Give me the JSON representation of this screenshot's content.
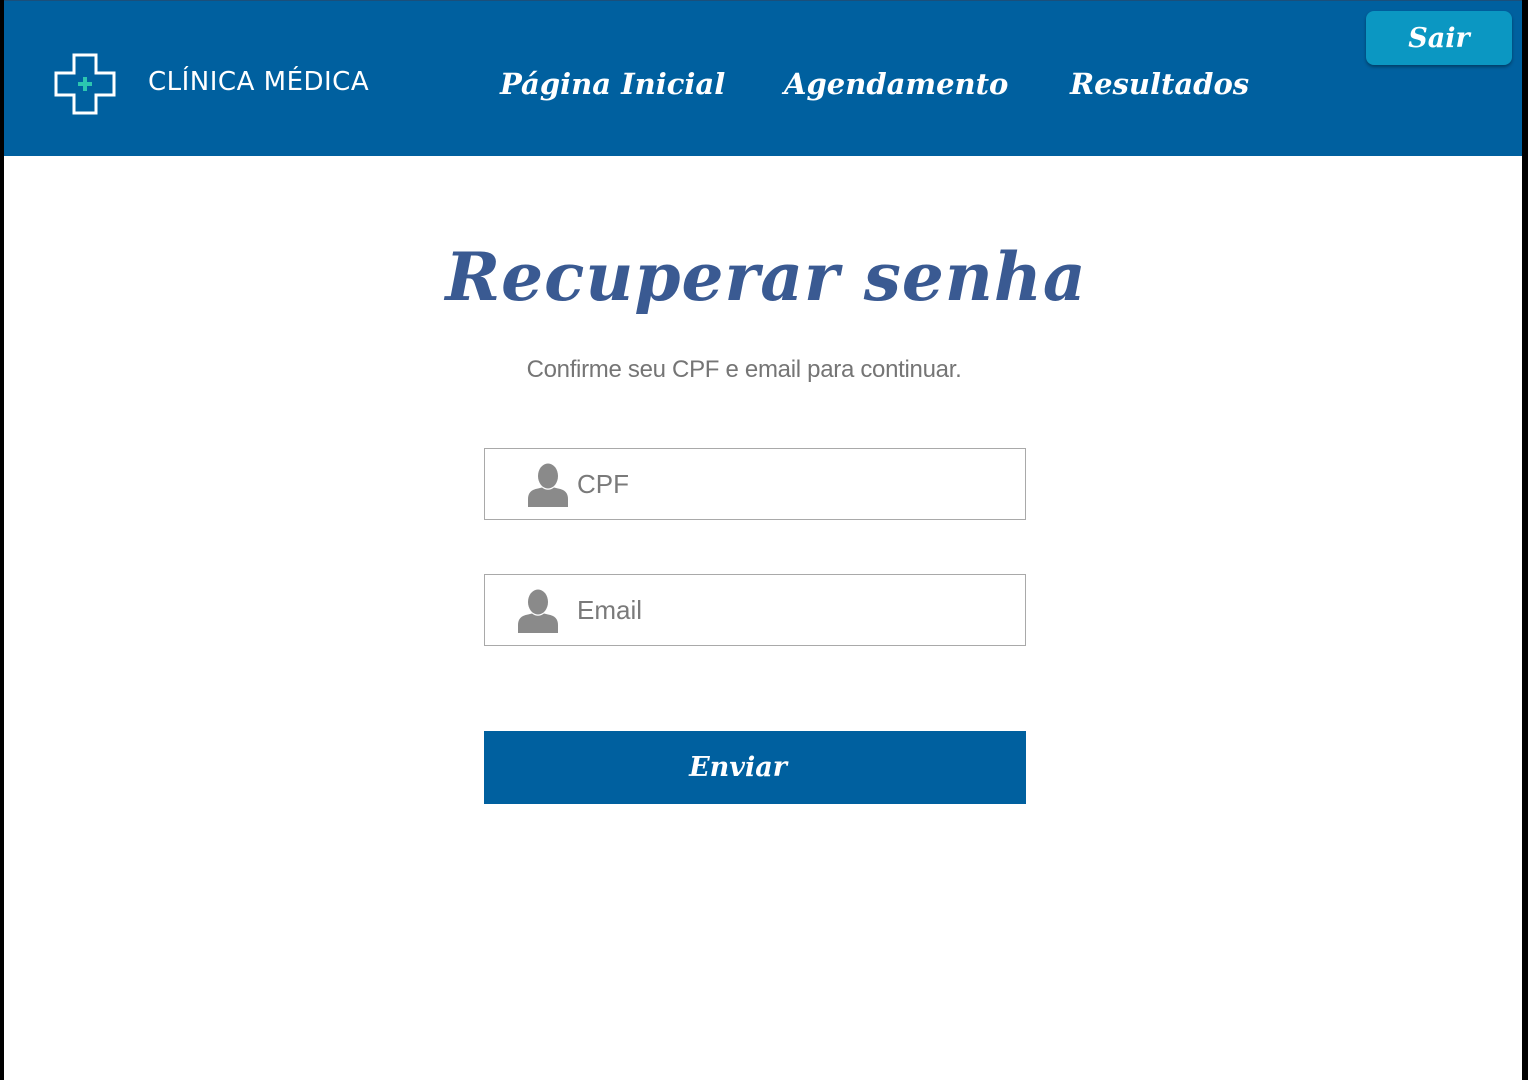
{
  "header": {
    "brand": "CLÍNICA MÉDICA",
    "logo_icon": "medical-cross-icon",
    "nav": {
      "home": "Página Inicial",
      "schedule": "Agendamento",
      "results": "Resultados"
    },
    "logout_label": "Sair"
  },
  "main": {
    "title": "Recuperar senha",
    "subtitle": "Confirme seu CPF e email para continuar.",
    "cpf_placeholder": "CPF",
    "email_placeholder": "Email",
    "field_icon": "user-icon",
    "submit_label": "Enviar"
  },
  "colors": {
    "header_bg": "#00609f",
    "logout_bg": "#0b97c2",
    "title": "#3a5a92",
    "accent_cross": "#2cc6b0"
  }
}
